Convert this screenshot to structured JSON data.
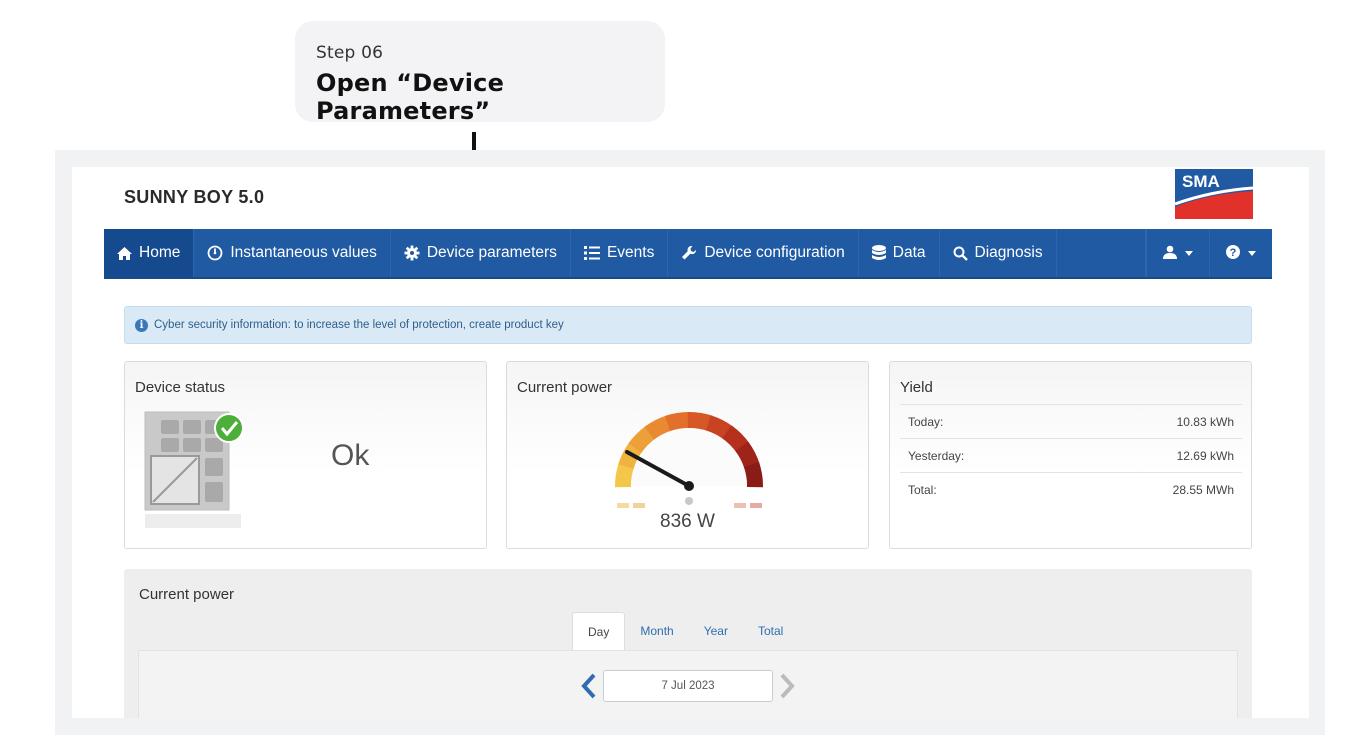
{
  "step": {
    "number": "Step 06",
    "title": "Open “Device Parameters”"
  },
  "app": {
    "title": "SUNNY BOY 5.0",
    "logo_text": "SMA"
  },
  "nav": {
    "home": "Home",
    "instantaneous": "Instantaneous values",
    "device_parameters": "Device parameters",
    "events": "Events",
    "device_configuration": "Device configuration",
    "data": "Data",
    "diagnosis": "Diagnosis"
  },
  "info_banner": "Cyber security information: to increase the level of protection, create product key",
  "device_status": {
    "title": "Device status",
    "status": "Ok"
  },
  "current_power_panel": {
    "title": "Current power",
    "value": "836 W"
  },
  "yield": {
    "title": "Yield",
    "rows": [
      {
        "label": "Today:",
        "value": "10.83 kWh"
      },
      {
        "label": "Yesterday:",
        "value": "12.69 kWh"
      },
      {
        "label": "Total:",
        "value": "28.55 MWh"
      }
    ]
  },
  "chart_section": {
    "title": "Current power",
    "tabs": [
      "Day",
      "Month",
      "Year",
      "Total"
    ],
    "active_tab": "Day",
    "date": "7 Jul 2023"
  },
  "colors": {
    "nav_blue": "#1f5aa3",
    "sma_blue": "#1f5aa3",
    "sma_red": "#e2302b",
    "link": "#2f6db0",
    "ok_green": "#4caf3a"
  },
  "icons": [
    "home-icon",
    "gauge-icon",
    "gear-icon",
    "list-icon",
    "wrench-icon",
    "database-icon",
    "search-icon",
    "user-icon",
    "help-icon",
    "info-icon",
    "check-icon",
    "chevron-left-icon",
    "chevron-right-icon",
    "arrow-down-icon"
  ]
}
